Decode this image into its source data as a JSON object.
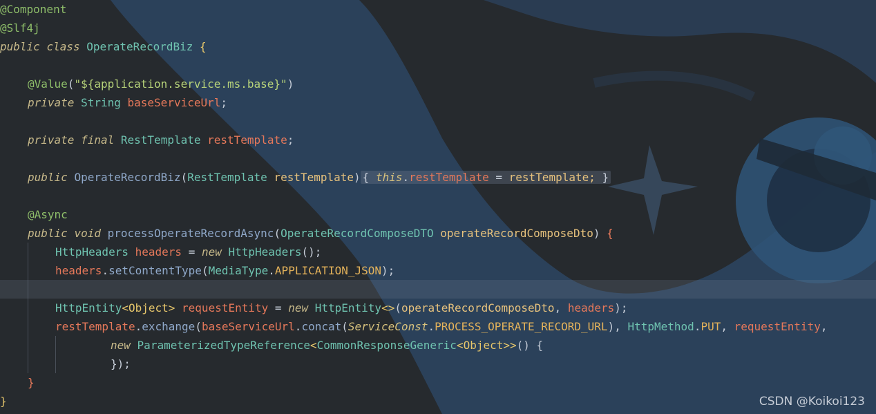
{
  "colors": {
    "background": "#262a2e",
    "annotation": "#8fbf6a",
    "keyword": "#c7b98a",
    "type": "#6fc3b0",
    "field": "#e5785a",
    "parameter": "#e7c27d",
    "method": "#8fa8c9",
    "string": "#b8d47a",
    "constant": "#e5b35a"
  },
  "code": {
    "l1": "@Component",
    "l2": "@Slf4j",
    "l3_kw1": "public",
    "l3_kw2": "class",
    "l3_name": "OperateRecordBiz",
    "l3_brace": "{",
    "l5_ann": "@Value",
    "l5_open": "(",
    "l5_str": "\"${application.service.ms.base}\"",
    "l5_close": ")",
    "l6_kw": "private",
    "l6_type": "String",
    "l6_field": "baseServiceUrl",
    "l6_end": ";",
    "l8_kw1": "private",
    "l8_kw2": "final",
    "l8_type": "RestTemplate",
    "l8_field": "restTemplate",
    "l8_end": ";",
    "l10_kw": "public",
    "l10_name": "OperateRecordBiz",
    "l10_open": "(",
    "l10_type": "RestTemplate",
    "l10_param": "restTemplate",
    "l10_close": ")",
    "l10_lbrace": "{",
    "l10_this": "this",
    "l10_dot": ".",
    "l10_field": "restTemplate",
    "l10_eq": "=",
    "l10_rhs": "restTemplate;",
    "l10_rbrace": "}",
    "l12_ann": "@Async",
    "l13_kw1": "public",
    "l13_kw2": "void",
    "l13_method": "processOperateRecordAsync",
    "l13_open": "(",
    "l13_type": "OperateRecordComposeDTO",
    "l13_param": "operateRecordComposeDto",
    "l13_close": ")",
    "l13_brace": "{",
    "l14_type": "HttpHeaders",
    "l14_var": "headers",
    "l14_eq": "=",
    "l14_new": "new",
    "l14_ctor": "HttpHeaders",
    "l14_end": "();",
    "l15_var": "headers",
    "l15_dot": ".",
    "l15_method": "setContentType",
    "l15_open": "(",
    "l15_cls": "MediaType",
    "l15_dot2": ".",
    "l15_const": "APPLICATION_JSON",
    "l15_end": ");",
    "l17_type": "HttpEntity",
    "l17_generic": "<Object>",
    "l17_var": "requestEntity",
    "l17_eq": "=",
    "l17_new": "new",
    "l17_ctor": "HttpEntity",
    "l17_diamond": "<>",
    "l17_open": "(",
    "l17_arg1": "operateRecordComposeDto",
    "l17_comma": ",",
    "l17_arg2": "headers",
    "l17_end": ");",
    "l18_var": "restTemplate",
    "l18_dot": ".",
    "l18_method": "exchange",
    "l18_open": "(",
    "l18_arg1": "baseServiceUrl",
    "l18_dot2": ".",
    "l18_method2": "concat",
    "l18_open2": "(",
    "l18_cls": "ServiceConst",
    "l18_dot3": ".",
    "l18_const": "PROCESS_OPERATE_RECORD_URL",
    "l18_close2": ")",
    "l18_comma1": ",",
    "l18_cls2": "HttpMethod",
    "l18_dot4": ".",
    "l18_const2": "PUT",
    "l18_comma2": ",",
    "l18_arg3": "requestEntity",
    "l18_comma3": ",",
    "l19_new": "new",
    "l19_type": "ParameterizedTypeReference",
    "l19_lt": "<",
    "l19_type2": "CommonResponseGeneric",
    "l19_generic": "<Object>",
    "l19_gt": ">",
    "l19_end": "()",
    "l19_brace": "{",
    "l20_end": "});",
    "l21_brace": "}",
    "l22_brace": "}"
  },
  "watermark": "CSDN @Koikoi123"
}
